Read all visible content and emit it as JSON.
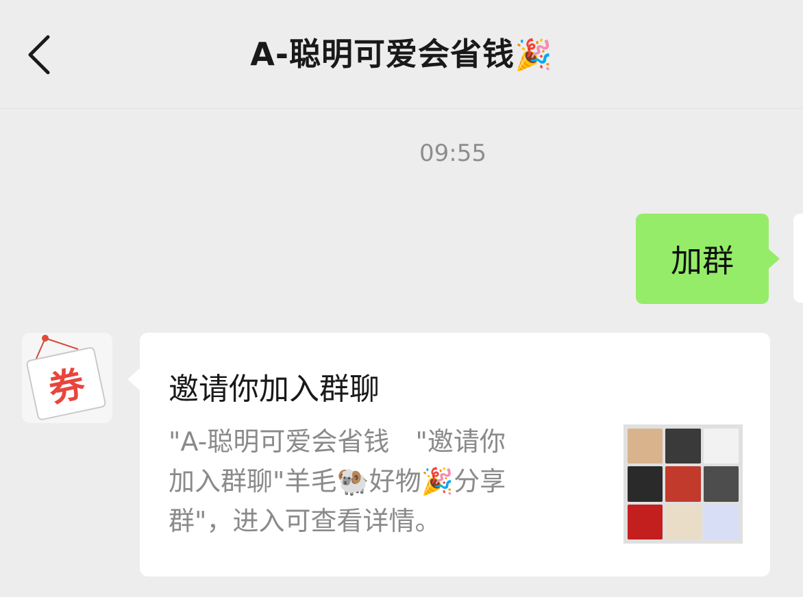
{
  "header": {
    "title": "A-聪明可爱会省钱",
    "title_emoji": "🎉"
  },
  "chat": {
    "timestamp": "09:55",
    "sent_message": {
      "text": "加群"
    },
    "received_card": {
      "avatar_text": "券",
      "title": "邀请你加入群聊",
      "description_lines": [
        "\"A-聪明可爱会省钱　\"邀请你",
        "加入群聊\"羊毛🐏好物🎉分享",
        "群\"，进入可查看详情。"
      ],
      "group_avatar_icons": [
        "member-avatar-1-icon",
        "member-avatar-2-icon",
        "member-avatar-3-icon",
        "member-avatar-4-icon",
        "member-avatar-5-icon",
        "member-avatar-6-icon",
        "member-avatar-7-icon",
        "member-avatar-8-icon",
        "member-avatar-9-icon"
      ],
      "group_avatar_colors": [
        "#d9b38c",
        "#3a3a3a",
        "#f2f2f2",
        "#2a2a2a",
        "#c23a2b",
        "#4d4d4d",
        "#c41f1f",
        "#e9ddc8",
        "#d9def7"
      ]
    }
  },
  "colors": {
    "background": "#ededed",
    "sent_bubble": "#95ec69",
    "card": "#ffffff",
    "coupon_red": "#e8453c"
  }
}
